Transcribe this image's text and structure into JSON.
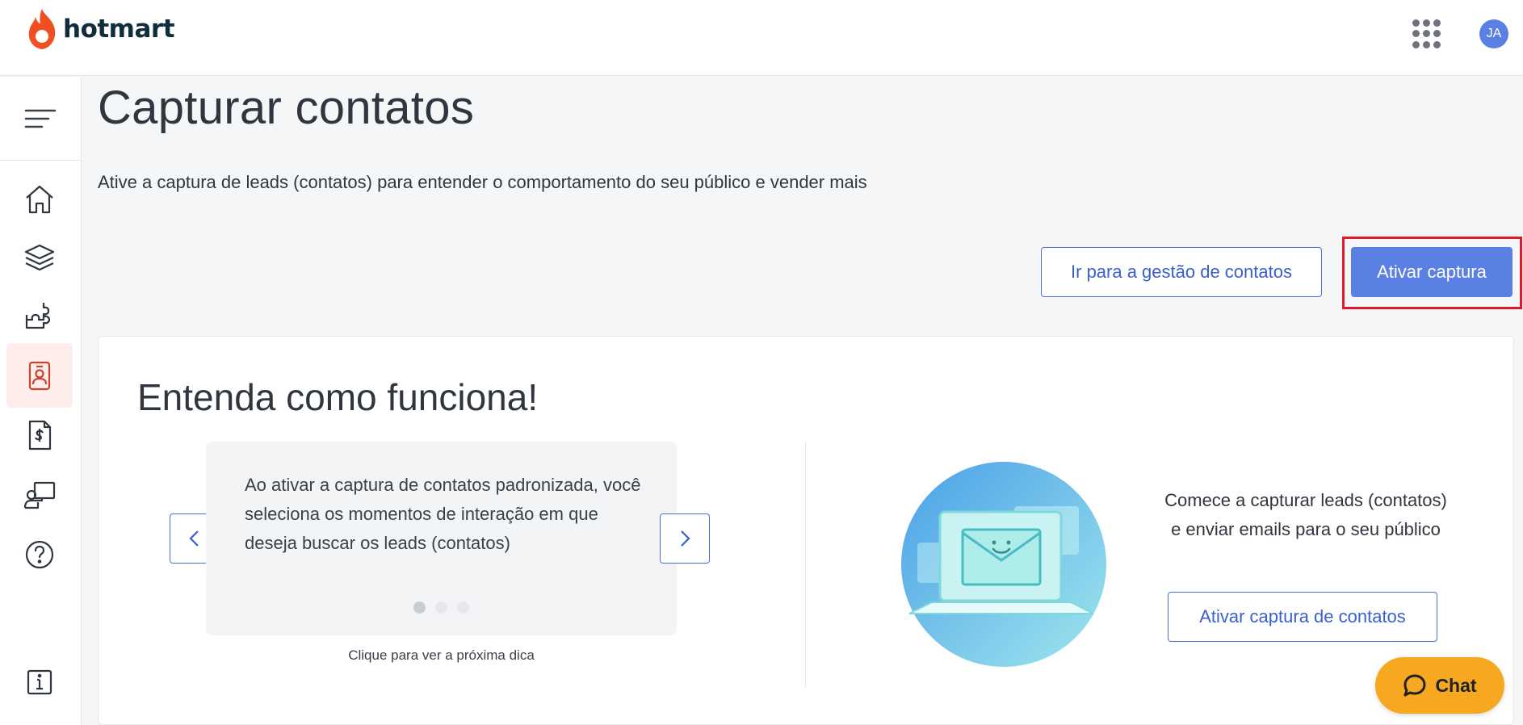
{
  "header": {
    "logo_text": "hotmart",
    "avatar_initials": "JA"
  },
  "sidebar": {
    "items": [
      {
        "name": "home",
        "icon": "home-icon"
      },
      {
        "name": "products",
        "icon": "layers-icon"
      },
      {
        "name": "tools",
        "icon": "puzzle-icon"
      },
      {
        "name": "contacts",
        "icon": "contact-card-icon",
        "active": true
      },
      {
        "name": "sales",
        "icon": "invoice-dollar-icon"
      },
      {
        "name": "learning",
        "icon": "presenter-board-icon"
      },
      {
        "name": "help",
        "icon": "question-icon"
      },
      {
        "name": "info",
        "icon": "info-icon"
      }
    ],
    "active_color": "#c9432f"
  },
  "main": {
    "title": "Capturar contatos",
    "subtitle": "Ative a captura de leads (contatos) para entender o comportamento do seu público e vender mais",
    "manage_button": "Ir para a gestão de contatos",
    "activate_button": "Ativar captura"
  },
  "card": {
    "title": "Entenda como funciona!",
    "tip_text": "Ao ativar a captura de contatos padronizada, você seleciona os momentos de interação em que deseja buscar os leads (contatos)",
    "tip_hint": "Clique para ver a próxima dica",
    "tip_count": 3,
    "tip_active_index": 0,
    "cta_text": "Comece a capturar leads (contatos) e enviar emails para o seu público",
    "cta_button": "Ativar captura de contatos"
  },
  "chat": {
    "label": "Chat"
  },
  "colors": {
    "primary": "#5b80e3",
    "highlight": "#e2182b",
    "chat": "#f6a821",
    "brand": "#f04e23"
  }
}
